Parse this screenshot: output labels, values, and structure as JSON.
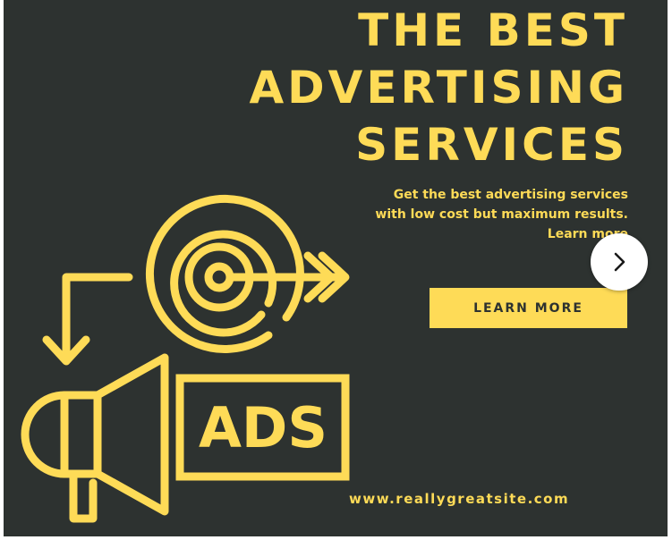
{
  "banner": {
    "headline_lines": [
      "THE BEST",
      "ADVERTISING",
      "SERVICES"
    ],
    "subtext_lines": [
      "Get the best advertising services",
      "with low cost but maximum results.",
      "Learn more"
    ],
    "cta_label": "LEARN MORE",
    "website": "www.reallygreatsite.com",
    "illustration": {
      "icons": [
        "target-icon",
        "arrow-icon",
        "megaphone-icon",
        "ads-sign-icon"
      ],
      "sign_text": "ADS"
    }
  },
  "carousel": {
    "next_icon": "chevron-right-icon"
  },
  "colors": {
    "background": "#2d3230",
    "accent": "#fedb57",
    "button_text": "#2d3230",
    "nav_button": "#ffffff"
  }
}
